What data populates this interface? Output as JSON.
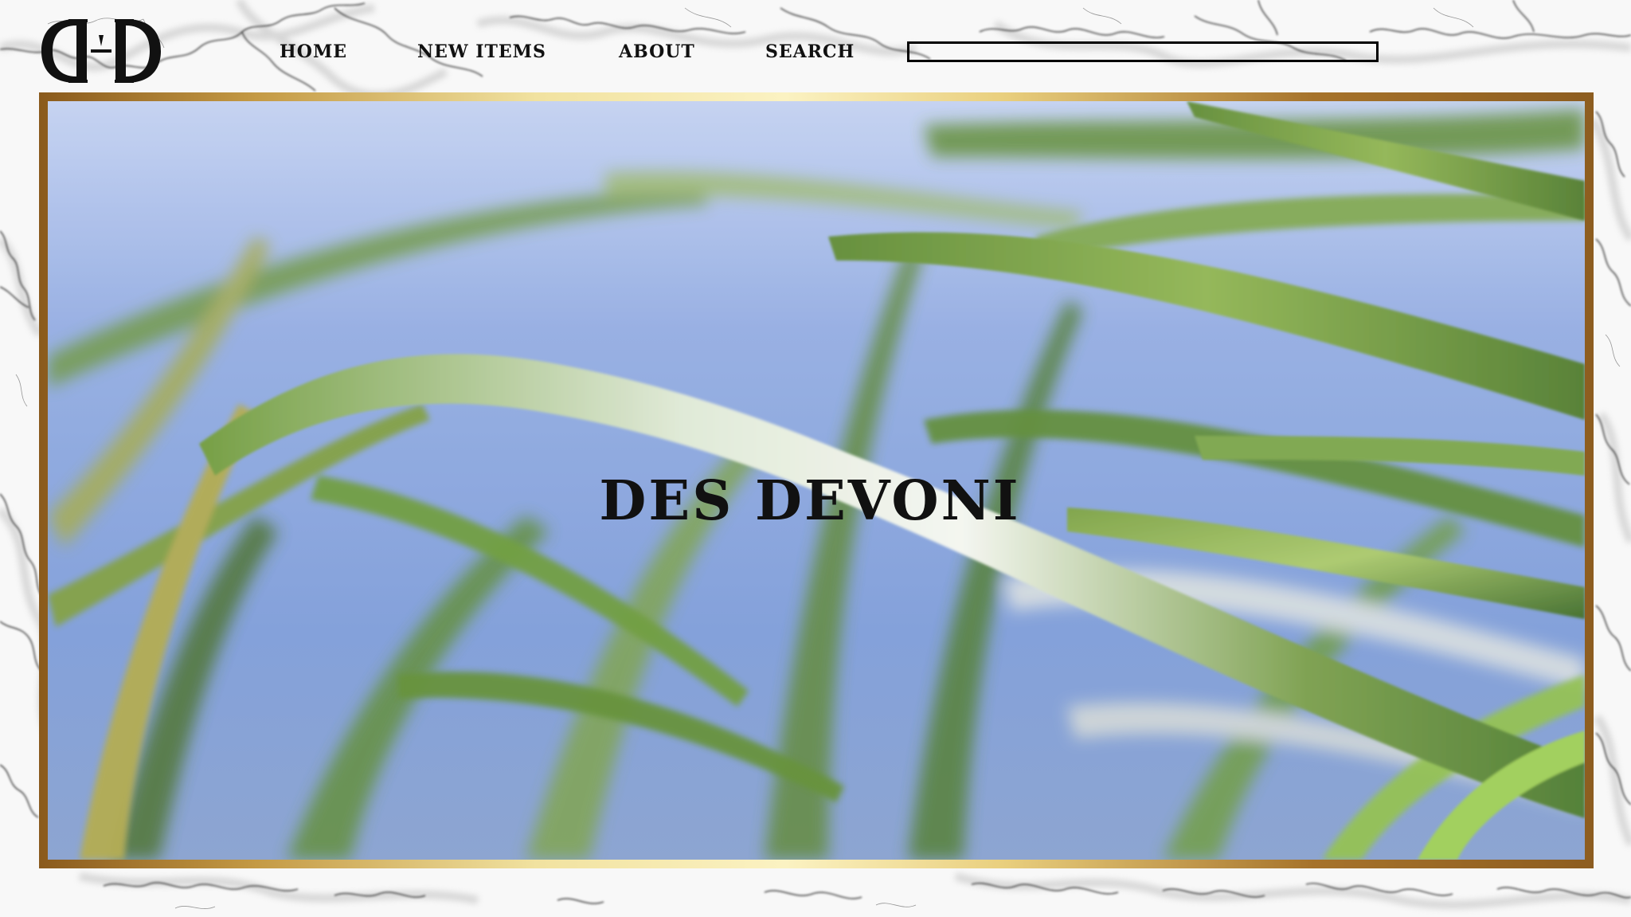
{
  "site": {
    "brand_name": "DES DEVONI",
    "logo_text": "DD"
  },
  "nav": {
    "items": [
      {
        "label": "HOME"
      },
      {
        "label": "NEW ITEMS"
      },
      {
        "label": "ABOUT"
      },
      {
        "label": "SEARCH"
      }
    ]
  },
  "search": {
    "value": "",
    "placeholder": ""
  },
  "hero": {
    "title": "DES DEVONI",
    "image_subject": "green palm leaves against a blue sky"
  },
  "colors": {
    "text": "#111111",
    "frame_gold": "#c49a45",
    "frame_bronze": "#8a5a1c",
    "sky": "#8fa9e2",
    "leaf": "#6f9a3a"
  }
}
